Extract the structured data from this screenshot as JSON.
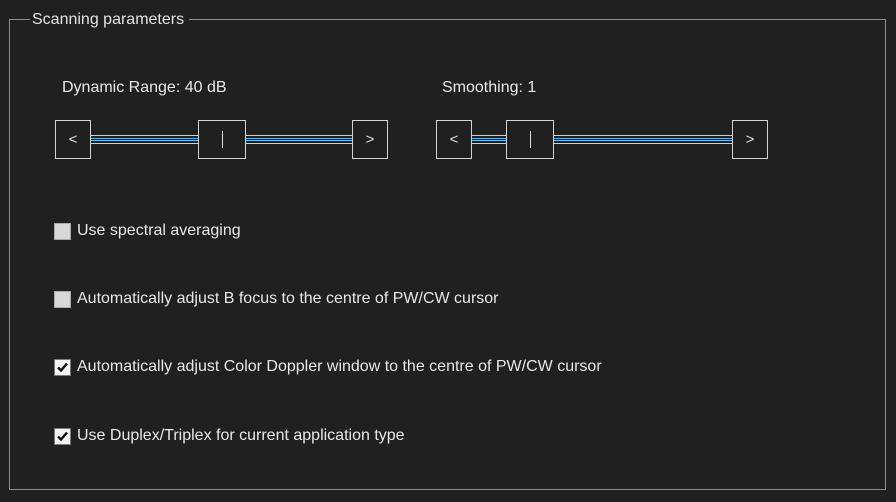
{
  "group": {
    "title": "Scanning parameters"
  },
  "sliders": [
    {
      "label": "Dynamic Range: 40 dB",
      "value_fraction": 0.5,
      "decrement_glyph": "<",
      "increment_glyph": ">"
    },
    {
      "label": "Smoothing: 1",
      "value_fraction": 0.16,
      "decrement_glyph": "<",
      "increment_glyph": ">"
    }
  ],
  "checkboxes": [
    {
      "label": "Use spectral averaging",
      "checked": false
    },
    {
      "label": "Automatically adjust B focus to the centre of PW/CW cursor",
      "checked": false
    },
    {
      "label": "Automatically adjust Color Doppler window to the centre of PW/CW cursor",
      "checked": true
    },
    {
      "label": "Use Duplex/Triplex for current application type",
      "checked": true
    }
  ],
  "icons": {
    "checkmark": "checkmark-icon",
    "slider_decrement": "chevron-left-icon",
    "slider_increment": "chevron-right-icon",
    "slider_thumb_grip": "grip-icon"
  },
  "colors": {
    "background": "#202020",
    "text": "#e8e8e8",
    "frame": "#8e8e8e",
    "track_accent": "#5bb3e8"
  }
}
